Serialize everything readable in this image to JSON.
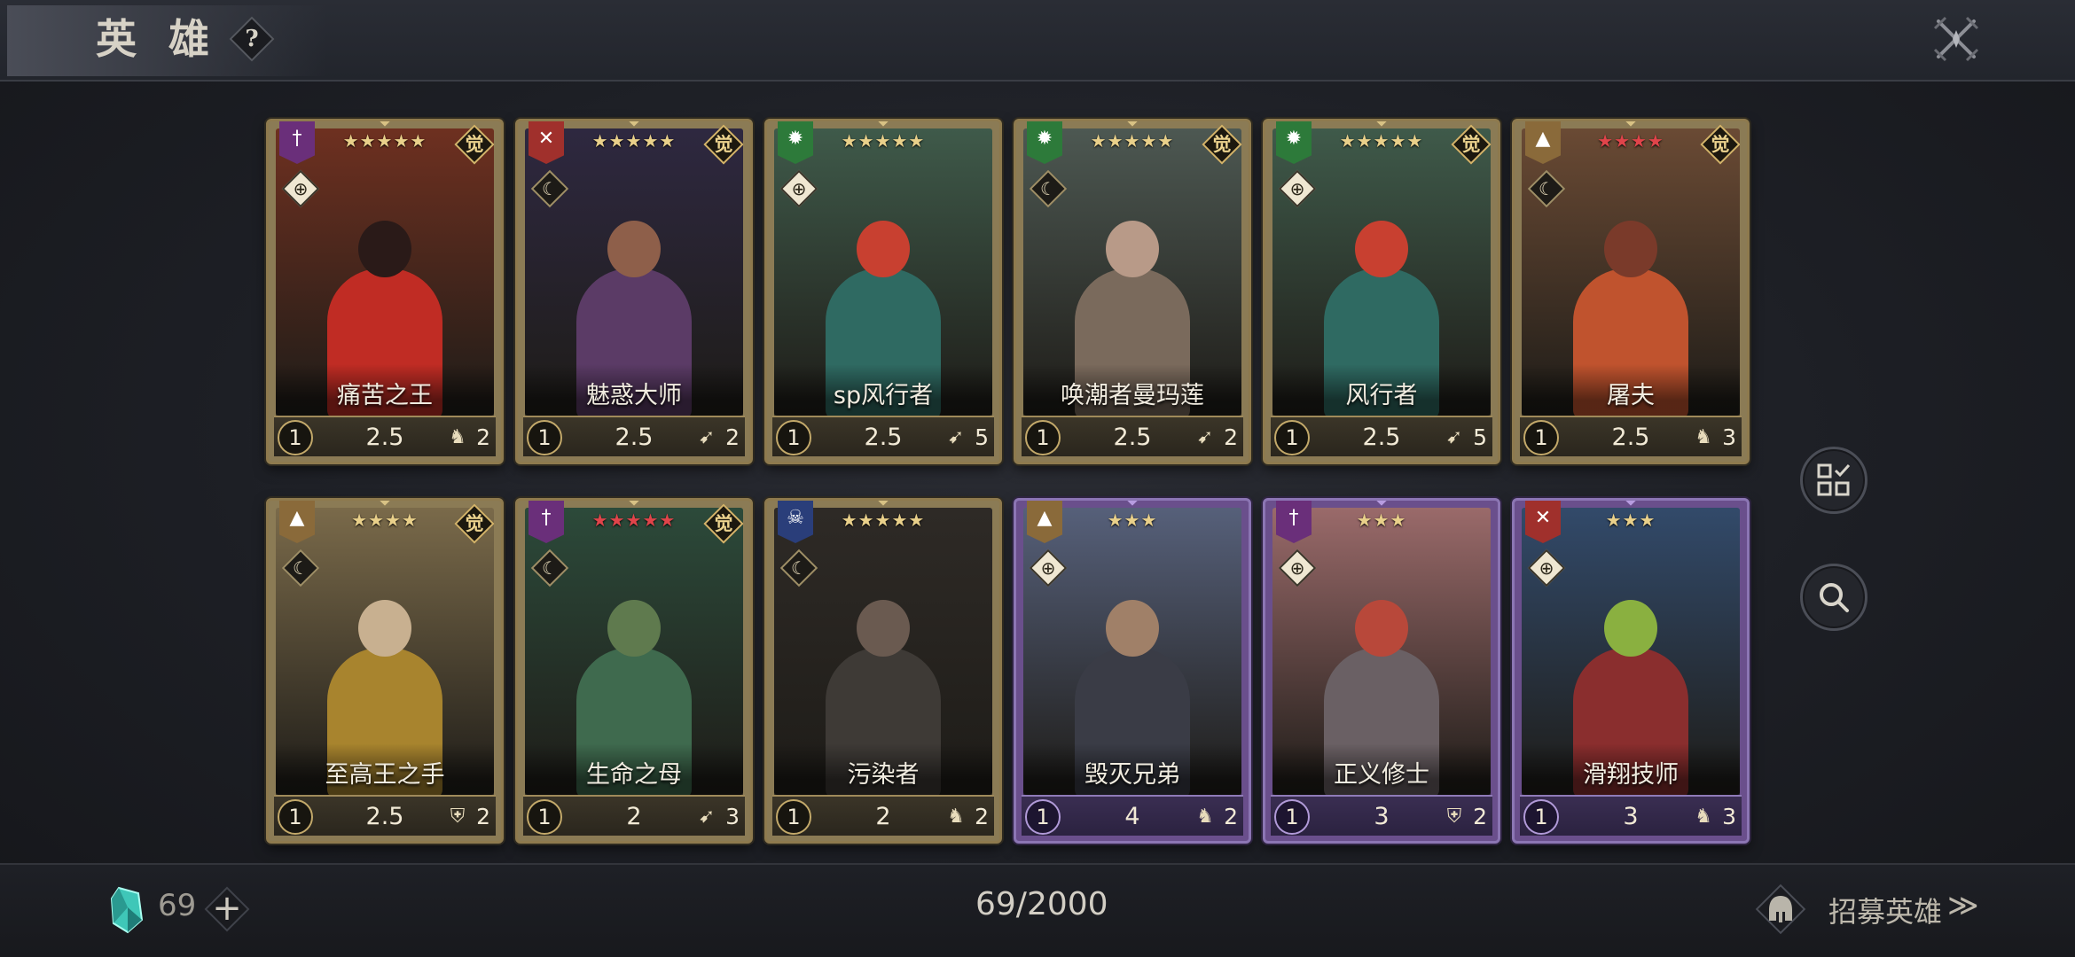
{
  "header": {
    "title": "英 雄",
    "help_label": "?"
  },
  "colors": {
    "gold_frame": "#8e7a4e",
    "purple_frame": "#8c76b4",
    "star_gold": "#e9d08a",
    "star_red": "#e0444a"
  },
  "cards": [
    {
      "name": "痛苦之王",
      "cost": "1",
      "speed": "2.5",
      "range": "2",
      "stars": "★★★★★",
      "star_color": "#e9d08a",
      "frame": "gold",
      "awakened": "觉",
      "faction_icon": "sword-banner-icon",
      "faction_color": "#6a2f7a",
      "faction_glyph": "†",
      "role_icon": "crosshair-icon",
      "role_glyph": "⊕",
      "role_style": "light",
      "type_icon": "horse-icon",
      "type_glyph": "♞",
      "art_bg": "#6e3020",
      "fig_color": "#c02c24",
      "head_color": "#2a1a18"
    },
    {
      "name": "魅惑大师",
      "cost": "1",
      "speed": "2.5",
      "range": "2",
      "stars": "★★★★★",
      "star_color": "#e9d08a",
      "frame": "gold",
      "awakened": "觉",
      "faction_icon": "crossed-swords-banner-icon",
      "faction_color": "#a0302c",
      "faction_glyph": "✕",
      "role_icon": "crescent-icon",
      "role_glyph": "☾",
      "role_style": "dark",
      "type_icon": "bow-icon",
      "type_glyph": "➹",
      "art_bg": "#2e2840",
      "fig_color": "#5b3b66",
      "head_color": "#8e5f4a"
    },
    {
      "name": "sp风行者",
      "cost": "1",
      "speed": "2.5",
      "range": "5",
      "stars": "★★★★★",
      "star_color": "#e9d08a",
      "frame": "gold",
      "awakened": "",
      "faction_icon": "sun-banner-icon",
      "faction_color": "#2d7a3a",
      "faction_glyph": "✹",
      "role_icon": "crosshair-icon",
      "role_glyph": "⊕",
      "role_style": "light",
      "type_icon": "bow-icon",
      "type_glyph": "➹",
      "art_bg": "#3f5a4a",
      "fig_color": "#2f6a62",
      "head_color": "#c84030"
    },
    {
      "name": "唤潮者曼玛莲",
      "cost": "1",
      "speed": "2.5",
      "range": "2",
      "stars": "★★★★★",
      "star_color": "#e9d08a",
      "frame": "gold",
      "awakened": "觉",
      "faction_icon": "sun-banner-icon",
      "faction_color": "#2d7a3a",
      "faction_glyph": "✹",
      "role_icon": "crescent-icon",
      "role_glyph": "☾",
      "role_style": "dark",
      "type_icon": "bow-icon",
      "type_glyph": "➹",
      "art_bg": "#4d5852",
      "fig_color": "#7a6a5c",
      "head_color": "#b89a88"
    },
    {
      "name": "风行者",
      "cost": "1",
      "speed": "2.5",
      "range": "5",
      "stars": "★★★★★",
      "star_color": "#e9d08a",
      "frame": "gold",
      "awakened": "觉",
      "faction_icon": "sun-banner-icon",
      "faction_color": "#2d7a3a",
      "faction_glyph": "✹",
      "role_icon": "crosshair-icon",
      "role_glyph": "⊕",
      "role_style": "light",
      "type_icon": "bow-icon",
      "type_glyph": "➹",
      "art_bg": "#3f5a4a",
      "fig_color": "#2f6a62",
      "head_color": "#c84030"
    },
    {
      "name": "屠夫",
      "cost": "1",
      "speed": "2.5",
      "range": "3",
      "stars": "★★★★",
      "star_color": "#e0444a",
      "frame": "gold",
      "awakened": "觉",
      "faction_icon": "mountain-banner-icon",
      "faction_color": "#8a6a3a",
      "faction_glyph": "▲",
      "role_icon": "crescent-icon",
      "role_glyph": "☾",
      "role_style": "dark",
      "type_icon": "horse-icon",
      "type_glyph": "♞",
      "art_bg": "#6a4a34",
      "fig_color": "#c0532e",
      "head_color": "#7a3a2a"
    },
    {
      "name": "至高王之手",
      "cost": "1",
      "speed": "2.5",
      "range": "2",
      "stars": "★★★★",
      "star_color": "#e9d08a",
      "frame": "gold",
      "awakened": "觉",
      "faction_icon": "mountain-banner-icon",
      "faction_color": "#8a6a3a",
      "faction_glyph": "▲",
      "role_icon": "crescent-icon",
      "role_glyph": "☾",
      "role_style": "dark",
      "type_icon": "shield-icon",
      "type_glyph": "⛨",
      "art_bg": "#7a6a4a",
      "fig_color": "#a8842e",
      "head_color": "#c8b090"
    },
    {
      "name": "生命之母",
      "cost": "1",
      "speed": "2",
      "range": "3",
      "stars": "★★★★★",
      "star_color": "#e0444a",
      "frame": "gold",
      "awakened": "觉",
      "faction_icon": "sword-banner-icon",
      "faction_color": "#6a2f7a",
      "faction_glyph": "†",
      "role_icon": "crescent-icon",
      "role_glyph": "☾",
      "role_style": "dark",
      "type_icon": "bow-icon",
      "type_glyph": "➹",
      "art_bg": "#2c4a3a",
      "fig_color": "#3f6a4e",
      "head_color": "#5f7a4e"
    },
    {
      "name": "污染者",
      "cost": "1",
      "speed": "2",
      "range": "2",
      "stars": "★★★★★",
      "star_color": "#e9d08a",
      "frame": "gold",
      "awakened": "",
      "faction_icon": "skull-banner-icon",
      "faction_color": "#2a3e7a",
      "faction_glyph": "☠",
      "role_icon": "crescent-icon",
      "role_glyph": "☾",
      "role_style": "dark",
      "type_icon": "horse-icon",
      "type_glyph": "♞",
      "art_bg": "#2e2a26",
      "fig_color": "#3e3a36",
      "head_color": "#6a5a50"
    },
    {
      "name": "毁灭兄弟",
      "cost": "1",
      "speed": "4",
      "range": "2",
      "stars": "★★★",
      "star_color": "#e9d08a",
      "frame": "purple",
      "awakened": "",
      "faction_icon": "mountain-banner-icon",
      "faction_color": "#8a6a3a",
      "faction_glyph": "▲",
      "role_icon": "crosshair-icon",
      "role_glyph": "⊕",
      "role_style": "light",
      "type_icon": "horse-icon",
      "type_glyph": "♞",
      "art_bg": "#56607a",
      "fig_color": "#3a3c46",
      "head_color": "#a08068"
    },
    {
      "name": "正义修士",
      "cost": "1",
      "speed": "3",
      "range": "2",
      "stars": "★★★",
      "star_color": "#e9d08a",
      "frame": "purple",
      "awakened": "",
      "faction_icon": "sword-banner-icon",
      "faction_color": "#6a2f7a",
      "faction_glyph": "†",
      "role_icon": "crosshair-icon",
      "role_glyph": "⊕",
      "role_style": "light",
      "type_icon": "shield-icon",
      "type_glyph": "⛨",
      "art_bg": "#9a6a6a",
      "fig_color": "#6a6064",
      "head_color": "#b8483a"
    },
    {
      "name": "滑翔技师",
      "cost": "1",
      "speed": "3",
      "range": "3",
      "stars": "★★★",
      "star_color": "#e9d08a",
      "frame": "purple",
      "awakened": "",
      "faction_icon": "crossed-swords-banner-icon",
      "faction_color": "#a0302c",
      "faction_glyph": "✕",
      "role_icon": "crosshair-icon",
      "role_glyph": "⊕",
      "role_style": "light",
      "type_icon": "horse-icon",
      "type_glyph": "♞",
      "art_bg": "#324a6a",
      "fig_color": "#8a2e2e",
      "head_color": "#8ab040"
    }
  ],
  "side_buttons": [
    {
      "icon": "checklist-grid-icon"
    },
    {
      "icon": "search-icon"
    }
  ],
  "footer": {
    "crystal_count": "69",
    "add_label": "+",
    "capacity_current": "69",
    "capacity_max": "2000",
    "capacity_text": "69/2000",
    "recruit_label": "招募英雄",
    "recruit_chevron": "≫"
  }
}
